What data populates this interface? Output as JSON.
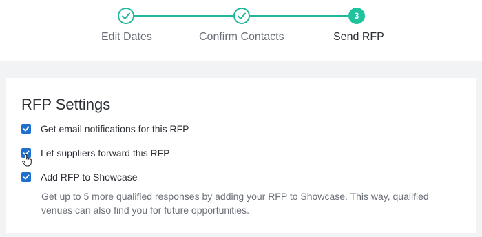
{
  "stepper": {
    "steps": [
      {
        "label": "Edit Dates",
        "state": "completed",
        "icon": "check-icon"
      },
      {
        "label": "Confirm Contacts",
        "state": "completed",
        "icon": "check-icon"
      },
      {
        "label": "Send RFP",
        "state": "current",
        "number": "3"
      }
    ],
    "accent_color": "#1fb89a"
  },
  "settings": {
    "title": "RFP Settings",
    "options": [
      {
        "label": "Get email notifications for this RFP",
        "checked": true
      },
      {
        "label": "Let suppliers forward this RFP",
        "checked": true
      },
      {
        "label": "Add RFP to Showcase",
        "checked": true
      }
    ],
    "showcase_help": "Get up to 5 more qualified responses by adding your RFP to Showcase. This way, qualified venues can also find you for future opportunities.",
    "checkbox_color": "#1f6fd1"
  }
}
